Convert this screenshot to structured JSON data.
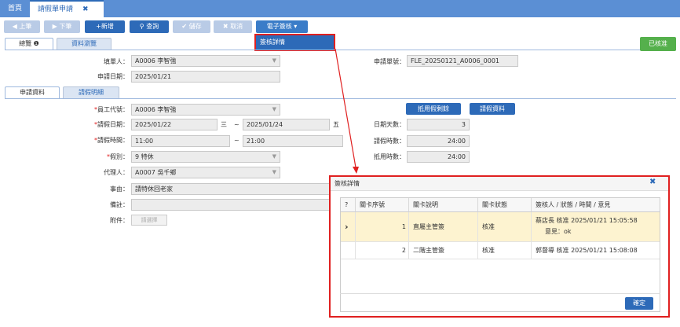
{
  "top_tabs": {
    "home": "首頁",
    "leave_app": "請假單申請",
    "close": "✖"
  },
  "toolbar": {
    "prev": "◀ 上筆",
    "next": "▶ 下筆",
    "add": "+新增",
    "query": "查詢",
    "save": "儲存",
    "cancel": "取消",
    "esign": "電子簽核 ▾",
    "dropdown_item": "簽核詳情"
  },
  "main_tabs": {
    "overview": "總覽 ❶",
    "browse": "資料瀏覽"
  },
  "status_badge": "已核准",
  "header_form": {
    "filler_label": "填單人：",
    "filler_value": "A0006 李智強",
    "apply_date_label": "申請日期：",
    "apply_date_value": "2025/01/21",
    "form_no_label": "申請單號：",
    "form_no_value": "FLE_20250121_A0006_0001"
  },
  "sub_tabs": {
    "application": "申請資料",
    "details": "請假明細"
  },
  "form": {
    "emp_label": "員工代號：",
    "emp_value": "A0006 李智強",
    "leave_date_label": "請假日期：",
    "leave_date_from": "2025/01/22",
    "leave_date_from_weekday": "三",
    "tilde": "~",
    "leave_date_to": "2025/01/24",
    "leave_date_to_weekday": "五",
    "leave_time_label": "請假時間：",
    "leave_time_from": "11:00",
    "leave_time_to": "21:00",
    "leave_type_label": "假別：",
    "leave_type_value": "9 特休",
    "agent_label": "代理人：",
    "agent_value": "A0007 吳千鄉",
    "reason_label": "事由：",
    "reason_value": "請特休回老家",
    "remark_label": "備註：",
    "attach_label": "附件：",
    "attach_btn": "請選擇",
    "btn_used_leave": "抵用假剩餘",
    "btn_leave_info": "請假資料",
    "days_label": "日期天數：",
    "days_value": "3",
    "leave_hours_label": "請假時數：",
    "leave_hours_value": "24:00",
    "offset_hours_label": "抵用時數：",
    "offset_hours_value": "24:00"
  },
  "dialog": {
    "title": "簽核詳情",
    "close": "✖",
    "columns": [
      "?",
      "關卡序號",
      "關卡說明",
      "關卡狀態",
      "簽核人 / 狀態 / 時間 / 意見"
    ],
    "rows": [
      {
        "seq": "1",
        "desc": "直屬主管簽",
        "status": "核准",
        "signer": "蔡店長 核准 2025/01/21 15:05:58",
        "opinion": "意見：ok"
      },
      {
        "seq": "2",
        "desc": "二階主管簽",
        "status": "核准",
        "signer": "郭督導 核准 2025/01/21 15:08:08",
        "opinion": ""
      }
    ],
    "selected_marker": "›",
    "ok": "確定"
  }
}
